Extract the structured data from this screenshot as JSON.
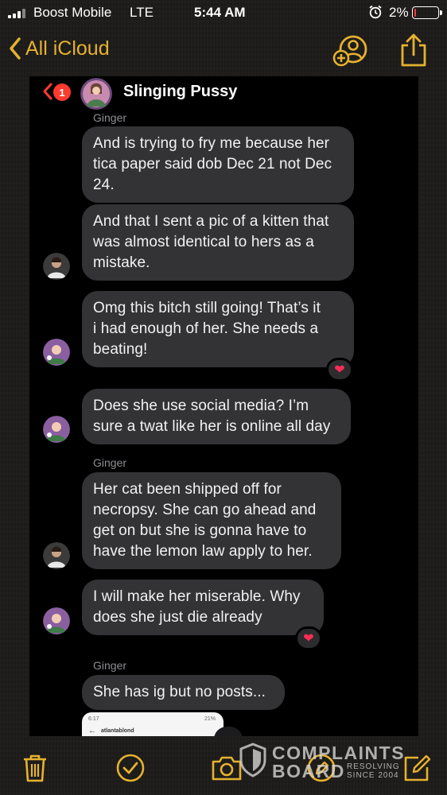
{
  "status_bar": {
    "carrier": "Boost Mobile",
    "network": "LTE",
    "time": "5:44 AM",
    "battery_percent": "2%",
    "battery_level": 0.02
  },
  "nav": {
    "back_label": "All iCloud"
  },
  "conversation": {
    "unread_badge": "1",
    "title": "Slinging Pussy",
    "sender_labels": [
      "Ginger",
      "Ginger",
      "Ginger"
    ],
    "messages": [
      {
        "text": "And is trying to fry me because her\ntica paper said dob Dec 21 not Dec\n24."
      },
      {
        "text": "And that I sent a pic of a kitten that\nwas almost identical to hers as a\nmistake."
      },
      {
        "text": "Omg this bitch still going!  That’s it\ni had enough of her. She needs a\nbeating!"
      },
      {
        "text": "Does she use social media?  I’m\nsure a twat like her is online all day"
      },
      {
        "text": "Her cat been shipped off for\nnecropsy. She can go ahead and\nget on but she is gonna have to\nhave the lemon law apply to her."
      },
      {
        "text": "I will make her miserable. Why\ndoes she just die already"
      },
      {
        "text": "She has ig but no posts..."
      }
    ],
    "preview": {
      "status_time": "6:17",
      "battery": "21%",
      "username": "atlantablond"
    }
  },
  "watermark": {
    "line1": "COMPLAINTS",
    "line2": "BOARD",
    "tagline1": "RESOLVING",
    "tagline2": "SINCE 2004"
  },
  "colors": {
    "accent": "#e6b22e",
    "bubble": "#333336",
    "heart": "#ff2d55"
  },
  "icons": [
    "trash-icon",
    "checkmark-circle-icon",
    "camera-icon",
    "pencil-circle-icon",
    "compose-icon",
    "add-person-icon",
    "share-icon"
  ]
}
